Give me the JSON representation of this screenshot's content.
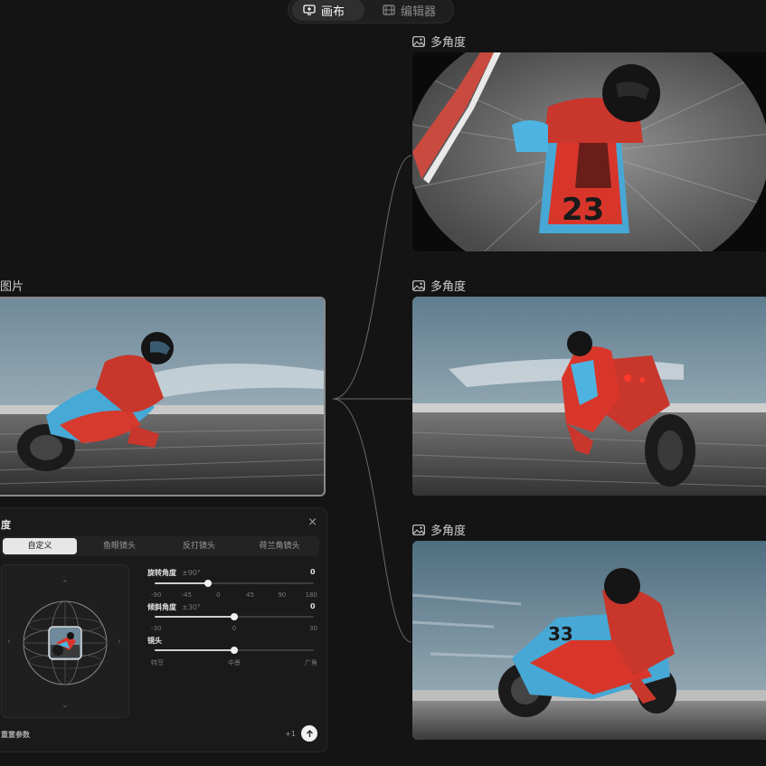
{
  "mode_switch": {
    "canvas_label": "画布",
    "editor_label": "编辑器"
  },
  "source_node": {
    "title": "图片",
    "icon": "image-icon"
  },
  "output_nodes": [
    {
      "title": "多角度",
      "icon": "image-icon"
    },
    {
      "title": "多角度",
      "icon": "image-icon"
    },
    {
      "title": "多角度",
      "icon": "image-icon"
    }
  ],
  "panel": {
    "title": "度",
    "close_label": "×",
    "tabs": [
      "自定义",
      "鱼眼镜头",
      "反打镜头",
      "荷兰角镜头"
    ],
    "active_tab": 0,
    "sliders": [
      {
        "label": "旋转角度",
        "range": "±90°",
        "value": "0",
        "position": 0.333,
        "ticks": [
          "-90",
          "-45",
          "0",
          "45",
          "90",
          "180"
        ]
      },
      {
        "label": "倾斜角度",
        "range": "±30°",
        "value": "0",
        "position": 0.5,
        "ticks": [
          "-30",
          "0",
          "30"
        ]
      },
      {
        "label": "镜头",
        "range": "",
        "value": "",
        "position": 0.5,
        "ticks": [
          "特写",
          "中景",
          "广角"
        ]
      }
    ],
    "footer_label": "重置参数",
    "count": "+1",
    "submit_icon": "arrow-up-icon",
    "nav_icons": [
      "chevron-up-icon",
      "chevron-down-icon",
      "chevron-left-icon",
      "chevron-right-icon"
    ]
  },
  "colors": {
    "background": "#141414",
    "panel": "#1a1a1a",
    "accent_red": "#d43a2f",
    "accent_blue": "#4db3e0"
  }
}
